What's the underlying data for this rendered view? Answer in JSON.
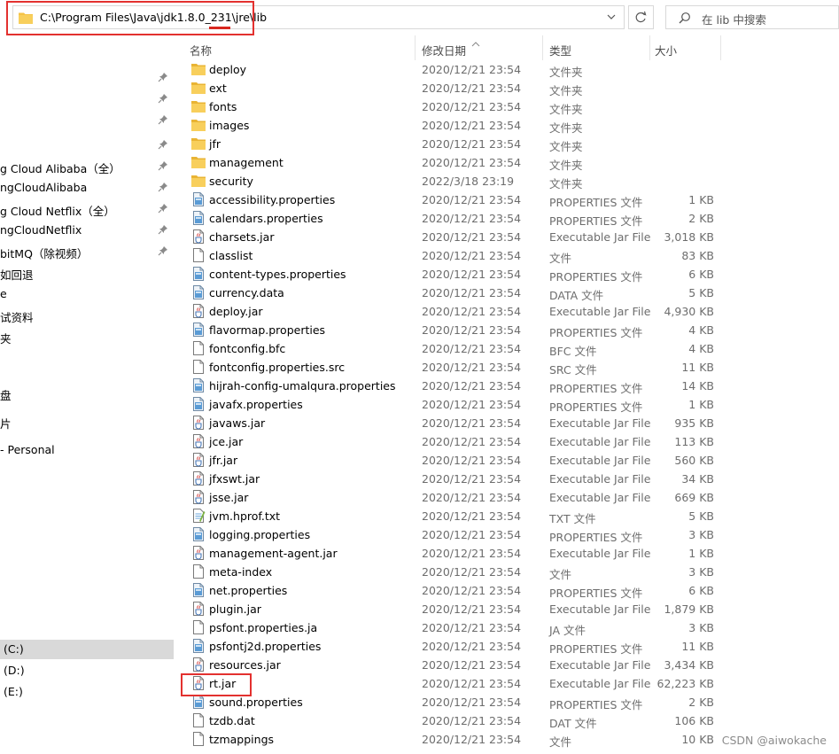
{
  "address_bar": {
    "path": "C:\\Program Files\\Java\\jdk1.8.0_231\\jre\\lib",
    "search_placeholder": "在 lib 中搜索"
  },
  "icons": {
    "folder": "folder-icon",
    "file": "file-icon",
    "properties": "properties-file-icon",
    "jar": "jar-file-icon",
    "text": "text-file-icon",
    "refresh": "refresh-icon",
    "search": "search-icon",
    "pin": "pin-icon",
    "dropdown": "chevron-down-icon"
  },
  "colors": {
    "highlight_border": "#e3312f",
    "folder_yellow": "#f5c347",
    "selected_nav_bg": "#d9d9d9"
  },
  "sidebar": {
    "items": [
      {
        "label": "",
        "pinned": true
      },
      {
        "label": "",
        "pinned": true
      },
      {
        "label": "",
        "pinned": true
      },
      {
        "label": "",
        "pinned": true
      },
      {
        "label": "g Cloud Alibaba（全）",
        "pinned": true
      },
      {
        "label": "ngCloudAlibaba",
        "pinned": true
      },
      {
        "label": "g Cloud Netflix（全）",
        "pinned": true
      },
      {
        "label": "ngCloudNetflix",
        "pinned": true
      },
      {
        "label": "bitMQ（除视频）",
        "pinned": true
      },
      {
        "label": "如回退",
        "pinned": false
      },
      {
        "label": "e",
        "pinned": false
      },
      {
        "label": "试资料",
        "pinned": false
      },
      {
        "label": "夹",
        "pinned": false
      },
      {
        "label": "盘",
        "pinned": false
      },
      {
        "label": "片",
        "pinned": false
      },
      {
        "label": "- Personal",
        "pinned": false
      }
    ],
    "drives": [
      {
        "label": "(C:)",
        "selected": true
      },
      {
        "label": "(D:)",
        "selected": false
      },
      {
        "label": "(E:)",
        "selected": false
      }
    ]
  },
  "columns": {
    "name": "名称",
    "date": "修改日期",
    "type": "类型",
    "size": "大小"
  },
  "files": [
    {
      "name": "deploy",
      "date": "2020/12/21 23:54",
      "type": "文件夹",
      "size": "",
      "icon": "folder"
    },
    {
      "name": "ext",
      "date": "2020/12/21 23:54",
      "type": "文件夹",
      "size": "",
      "icon": "folder"
    },
    {
      "name": "fonts",
      "date": "2020/12/21 23:54",
      "type": "文件夹",
      "size": "",
      "icon": "folder"
    },
    {
      "name": "images",
      "date": "2020/12/21 23:54",
      "type": "文件夹",
      "size": "",
      "icon": "folder"
    },
    {
      "name": "jfr",
      "date": "2020/12/21 23:54",
      "type": "文件夹",
      "size": "",
      "icon": "folder"
    },
    {
      "name": "management",
      "date": "2020/12/21 23:54",
      "type": "文件夹",
      "size": "",
      "icon": "folder"
    },
    {
      "name": "security",
      "date": "2022/3/18 23:19",
      "type": "文件夹",
      "size": "",
      "icon": "folder"
    },
    {
      "name": "accessibility.properties",
      "date": "2020/12/21 23:54",
      "type": "PROPERTIES 文件",
      "size": "1 KB",
      "icon": "properties"
    },
    {
      "name": "calendars.properties",
      "date": "2020/12/21 23:54",
      "type": "PROPERTIES 文件",
      "size": "2 KB",
      "icon": "properties"
    },
    {
      "name": "charsets.jar",
      "date": "2020/12/21 23:54",
      "type": "Executable Jar File",
      "size": "3,018 KB",
      "icon": "jar"
    },
    {
      "name": "classlist",
      "date": "2020/12/21 23:54",
      "type": "文件",
      "size": "83 KB",
      "icon": "file"
    },
    {
      "name": "content-types.properties",
      "date": "2020/12/21 23:54",
      "type": "PROPERTIES 文件",
      "size": "6 KB",
      "icon": "properties"
    },
    {
      "name": "currency.data",
      "date": "2020/12/21 23:54",
      "type": "DATA 文件",
      "size": "5 KB",
      "icon": "properties"
    },
    {
      "name": "deploy.jar",
      "date": "2020/12/21 23:54",
      "type": "Executable Jar File",
      "size": "4,930 KB",
      "icon": "jar"
    },
    {
      "name": "flavormap.properties",
      "date": "2020/12/21 23:54",
      "type": "PROPERTIES 文件",
      "size": "4 KB",
      "icon": "properties"
    },
    {
      "name": "fontconfig.bfc",
      "date": "2020/12/21 23:54",
      "type": "BFC 文件",
      "size": "4 KB",
      "icon": "file"
    },
    {
      "name": "fontconfig.properties.src",
      "date": "2020/12/21 23:54",
      "type": "SRC 文件",
      "size": "11 KB",
      "icon": "file"
    },
    {
      "name": "hijrah-config-umalqura.properties",
      "date": "2020/12/21 23:54",
      "type": "PROPERTIES 文件",
      "size": "14 KB",
      "icon": "properties"
    },
    {
      "name": "javafx.properties",
      "date": "2020/12/21 23:54",
      "type": "PROPERTIES 文件",
      "size": "1 KB",
      "icon": "properties"
    },
    {
      "name": "javaws.jar",
      "date": "2020/12/21 23:54",
      "type": "Executable Jar File",
      "size": "935 KB",
      "icon": "jar"
    },
    {
      "name": "jce.jar",
      "date": "2020/12/21 23:54",
      "type": "Executable Jar File",
      "size": "113 KB",
      "icon": "jar"
    },
    {
      "name": "jfr.jar",
      "date": "2020/12/21 23:54",
      "type": "Executable Jar File",
      "size": "560 KB",
      "icon": "jar"
    },
    {
      "name": "jfxswt.jar",
      "date": "2020/12/21 23:54",
      "type": "Executable Jar File",
      "size": "34 KB",
      "icon": "jar"
    },
    {
      "name": "jsse.jar",
      "date": "2020/12/21 23:54",
      "type": "Executable Jar File",
      "size": "669 KB",
      "icon": "jar"
    },
    {
      "name": "jvm.hprof.txt",
      "date": "2020/12/21 23:54",
      "type": "TXT 文件",
      "size": "5 KB",
      "icon": "text"
    },
    {
      "name": "logging.properties",
      "date": "2020/12/21 23:54",
      "type": "PROPERTIES 文件",
      "size": "3 KB",
      "icon": "properties"
    },
    {
      "name": "management-agent.jar",
      "date": "2020/12/21 23:54",
      "type": "Executable Jar File",
      "size": "1 KB",
      "icon": "jar"
    },
    {
      "name": "meta-index",
      "date": "2020/12/21 23:54",
      "type": "文件",
      "size": "3 KB",
      "icon": "file"
    },
    {
      "name": "net.properties",
      "date": "2020/12/21 23:54",
      "type": "PROPERTIES 文件",
      "size": "6 KB",
      "icon": "properties"
    },
    {
      "name": "plugin.jar",
      "date": "2020/12/21 23:54",
      "type": "Executable Jar File",
      "size": "1,879 KB",
      "icon": "jar"
    },
    {
      "name": "psfont.properties.ja",
      "date": "2020/12/21 23:54",
      "type": "JA 文件",
      "size": "3 KB",
      "icon": "file"
    },
    {
      "name": "psfontj2d.properties",
      "date": "2020/12/21 23:54",
      "type": "PROPERTIES 文件",
      "size": "11 KB",
      "icon": "properties"
    },
    {
      "name": "resources.jar",
      "date": "2020/12/21 23:54",
      "type": "Executable Jar File",
      "size": "3,434 KB",
      "icon": "jar"
    },
    {
      "name": "rt.jar",
      "date": "2020/12/21 23:54",
      "type": "Executable Jar File",
      "size": "62,223 KB",
      "icon": "jar"
    },
    {
      "name": "sound.properties",
      "date": "2020/12/21 23:54",
      "type": "PROPERTIES 文件",
      "size": "2 KB",
      "icon": "properties"
    },
    {
      "name": "tzdb.dat",
      "date": "2020/12/21 23:54",
      "type": "DAT 文件",
      "size": "106 KB",
      "icon": "file"
    },
    {
      "name": "tzmappings",
      "date": "2020/12/21 23:54",
      "type": "文件",
      "size": "10 KB",
      "icon": "file"
    }
  ],
  "watermark": "CSDN @aiwokache"
}
